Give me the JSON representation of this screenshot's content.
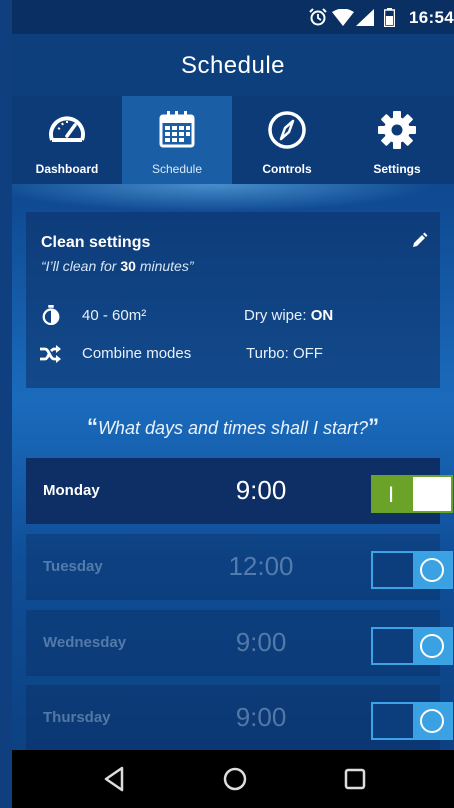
{
  "status_bar": {
    "time": "16:54",
    "icons": [
      "alarm-icon",
      "wifi-icon",
      "signal-icon",
      "battery-icon"
    ]
  },
  "header": {
    "title": "Schedule"
  },
  "nav": {
    "tabs": [
      {
        "label": "Dashboard",
        "icon": "gauge-icon",
        "active": false
      },
      {
        "label": "Schedule",
        "icon": "calendar-icon",
        "active": true
      },
      {
        "label": "Controls",
        "icon": "compass-icon",
        "active": false
      },
      {
        "label": "Settings",
        "icon": "gear-icon",
        "active": false
      }
    ]
  },
  "clean_settings": {
    "title": "Clean settings",
    "subtitle_prefix": "“I’ll clean for ",
    "minutes": "30",
    "subtitle_suffix": " minutes”",
    "area": "40 - 60m²",
    "dry_wipe_label": "Dry wipe: ",
    "dry_wipe_value": "ON",
    "mode": "Combine modes",
    "turbo": "Turbo: OFF"
  },
  "prompt": {
    "open_quote": "“",
    "text": "What days and times shall I start?",
    "close_quote": "”"
  },
  "schedule": [
    {
      "day": "Monday",
      "time": "9:00",
      "enabled": true,
      "switch_label": "I"
    },
    {
      "day": "Tuesday",
      "time": "12:00",
      "enabled": false
    },
    {
      "day": "Wednesday",
      "time": "9:00",
      "enabled": false
    },
    {
      "day": "Thursday",
      "time": "9:00",
      "enabled": false
    }
  ],
  "colors": {
    "accent_green": "#6aa328",
    "accent_blue": "#3aa1e3",
    "header": "#0e3f7d"
  }
}
